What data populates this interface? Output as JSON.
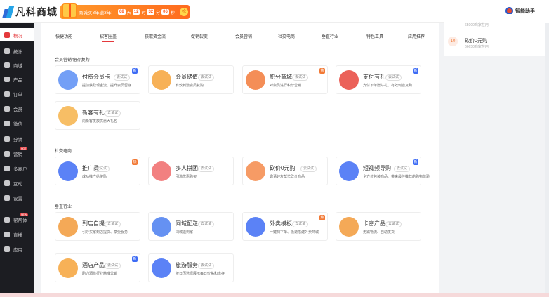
{
  "brand": {
    "name": "凡科商城"
  },
  "promo": {
    "text": "商城买3年送3年:",
    "d": "08",
    "d_u": "天",
    "h": "12",
    "h_u": "时",
    "m": "32",
    "m_u": "分",
    "s": "06",
    "s_u": "秒",
    "coin": "抢"
  },
  "helper": {
    "label": "智能助手"
  },
  "sidebar": {
    "items": [
      {
        "label": "概况"
      },
      {
        "label": "统计"
      },
      {
        "label": "商城"
      },
      {
        "label": "产品"
      },
      {
        "label": "订单"
      },
      {
        "label": "会员"
      },
      {
        "label": "微信"
      },
      {
        "label": "分销"
      },
      {
        "label": "营销",
        "badge": "HOT"
      },
      {
        "label": "多商户"
      },
      {
        "label": "互动"
      },
      {
        "label": "设置"
      },
      {
        "label": "帮帮体",
        "badge": "NEW"
      },
      {
        "label": "直播"
      },
      {
        "label": "应用"
      }
    ]
  },
  "tabs": [
    "快捷功能",
    "招客圈盖",
    "获取资金流",
    "促销裂变",
    "会员营销",
    "社交电商",
    "垂直行业",
    "特色工具",
    "应用推荐"
  ],
  "sections": [
    {
      "title": "会员营销/留存复购"
    },
    {
      "title": "社交电商"
    },
    {
      "title": "垂直行业"
    }
  ],
  "try_label": "去试试",
  "cards": [
    {
      "title": "付费会员卡",
      "desc": "提前获取现金流、提升会员留存",
      "badge": "新"
    },
    {
      "title": "会员储值",
      "desc": "有效刺激会员复购",
      "badge": ""
    },
    {
      "title": "积分商城",
      "desc": "对会员进行积分营销",
      "badge": "热"
    },
    {
      "title": "支付有礼",
      "desc": "支付下单赠好礼、有效刺激复购",
      "badge": "新"
    },
    {
      "title": "新客有礼",
      "desc": "向新客发放优惠大礼包",
      "badge": ""
    },
    {
      "title": "推广员",
      "desc": "成功推广给奖励",
      "badge": "热"
    },
    {
      "title": "多人拼团",
      "desc": "团满优惠购买",
      "badge": ""
    },
    {
      "title": "砍价0元购",
      "desc": "邀请好友帮忙砍价商品",
      "badge": ""
    },
    {
      "title": "短视频导购",
      "desc": "全方位包装商品、带来最佳推荐的购物体验",
      "badge": "新"
    },
    {
      "title": "到店自提",
      "desc": "引导买家到店提货、享受服务",
      "badge": ""
    },
    {
      "title": "同城配送",
      "desc": "同城送到家",
      "badge": ""
    },
    {
      "title": "外卖模板",
      "desc": "一键扫下单、低速搭建外卖商城",
      "badge": "热"
    },
    {
      "title": "卡密产品",
      "desc": "无需物流、自动发货",
      "badge": ""
    },
    {
      "title": "酒店产品",
      "desc": "助力酒旅行业精准营销",
      "badge": "新"
    },
    {
      "title": "旅游服务",
      "desc": "按日历选择展示每日价格和库存",
      "badge": ""
    }
  ],
  "colors": [
    "#5b8ef5",
    "#f6a33a",
    "#f27a3a",
    "#e8453c",
    "#f6b34a",
    "#3e6cf5",
    "#f06a6a",
    "#f58a4a",
    "#3e6cf5",
    "#f29a3a",
    "#4a7ef0",
    "#3e6cf5",
    "#f29a3a",
    "#f6a33a",
    "#3e6cf5"
  ],
  "right": {
    "sub0": "65000商家在用",
    "num": "10",
    "title": "砍价0元购",
    "sub": "66650商家在用"
  }
}
